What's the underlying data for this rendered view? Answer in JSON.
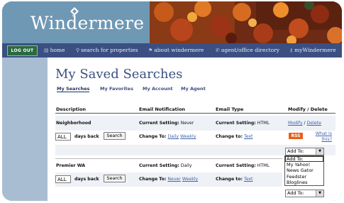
{
  "brand": {
    "name": "Windermere"
  },
  "nav": {
    "logout": "LOG OUT",
    "items": [
      {
        "label": "home",
        "icon": "page-icon"
      },
      {
        "label": "search for properties",
        "icon": "search-icon"
      },
      {
        "label": "about windermere",
        "icon": "flag-icon"
      },
      {
        "label": "agent/office directory",
        "icon": "phone-icon"
      },
      {
        "label": "myWindermere",
        "icon": "key-icon"
      }
    ]
  },
  "page": {
    "title": "My Saved Searches",
    "tabs": [
      "My Searches",
      "My Favorites",
      "My Account",
      "My Agent"
    ],
    "active_tab": "My Searches"
  },
  "table": {
    "headers": {
      "description": "Description",
      "notification": "Email Notification",
      "type": "Email Type",
      "modify": "Modify / Delete"
    },
    "rows": [
      {
        "name": "Neighborhood",
        "current_notification_label": "Current Setting:",
        "current_notification_value": "Never",
        "change_to_label": "Change To:",
        "change_options": [
          "Daily",
          "Weekly"
        ],
        "type_label": "Current Setting:",
        "type_value": "HTML",
        "type_change_label": "Change to:",
        "type_change_option": "Text",
        "modify": "Modify",
        "delete": "Delete",
        "days_value": "ALL",
        "days_label": "days back",
        "search_button": "Search",
        "rss": "RSS",
        "what_is_this": "What is this?",
        "add_to": "Add To:"
      },
      {
        "name": "Premier WA",
        "current_notification_label": "Current Setting:",
        "current_notification_value": "Daily",
        "change_to_label": "Change To:",
        "change_options": [
          "Never",
          "Weekly"
        ],
        "type_label": "Current Setting:",
        "type_value": "HTML",
        "type_change_label": "Change to:",
        "type_change_option": "Text",
        "days_value": "ALL",
        "days_label": "days back",
        "search_button": "Search",
        "add_to": "Add To:"
      }
    ],
    "dropdown_options": [
      "Add To:",
      "My Yahoo!",
      "News Gator",
      "Feedster",
      "Bloglines"
    ]
  },
  "colors": {
    "brand_blue": "#3b4f82",
    "frame_blue": "#5f8dab",
    "sidebar": "#a9bdd2",
    "rss_orange": "#e5601c",
    "logout_green": "#2a6a40",
    "link": "#3f63a8"
  }
}
